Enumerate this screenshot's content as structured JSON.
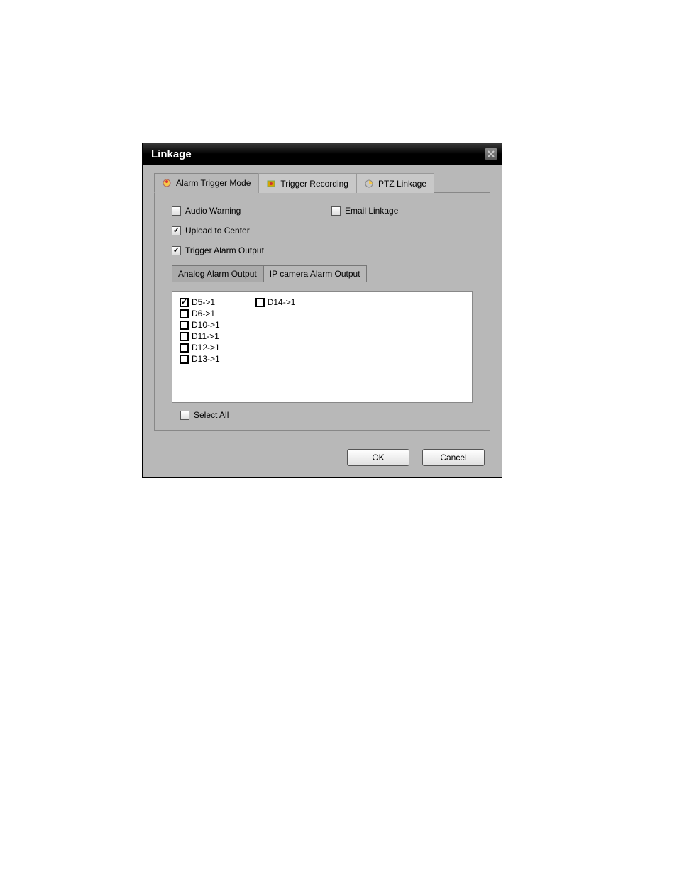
{
  "title": "Linkage",
  "tabs": [
    {
      "label": "Alarm Trigger Mode",
      "icon": "bell"
    },
    {
      "label": "Trigger Recording",
      "icon": "record"
    },
    {
      "label": "PTZ Linkage",
      "icon": "ptz"
    }
  ],
  "activeTab": 0,
  "options": {
    "audio_warning": {
      "label": "Audio Warning",
      "checked": false
    },
    "email_linkage": {
      "label": "Email Linkage",
      "checked": false
    },
    "upload_center": {
      "label": "Upload to Center",
      "checked": true
    },
    "trigger_alarm_output": {
      "label": "Trigger Alarm Output",
      "checked": true
    }
  },
  "subTabs": [
    {
      "label": "Analog Alarm Output"
    },
    {
      "label": "IP camera Alarm Output"
    }
  ],
  "activeSubTab": 1,
  "outputs_col1": [
    {
      "label": "D5->1",
      "checked": true
    },
    {
      "label": "D6->1",
      "checked": false
    },
    {
      "label": "D10->1",
      "checked": false
    },
    {
      "label": "D11->1",
      "checked": false
    },
    {
      "label": "D12->1",
      "checked": false
    },
    {
      "label": "D13->1",
      "checked": false
    }
  ],
  "outputs_col2": [
    {
      "label": "D14->1",
      "checked": false
    }
  ],
  "select_all": {
    "label": "Select All",
    "checked": false
  },
  "buttons": {
    "ok": "OK",
    "cancel": "Cancel"
  }
}
